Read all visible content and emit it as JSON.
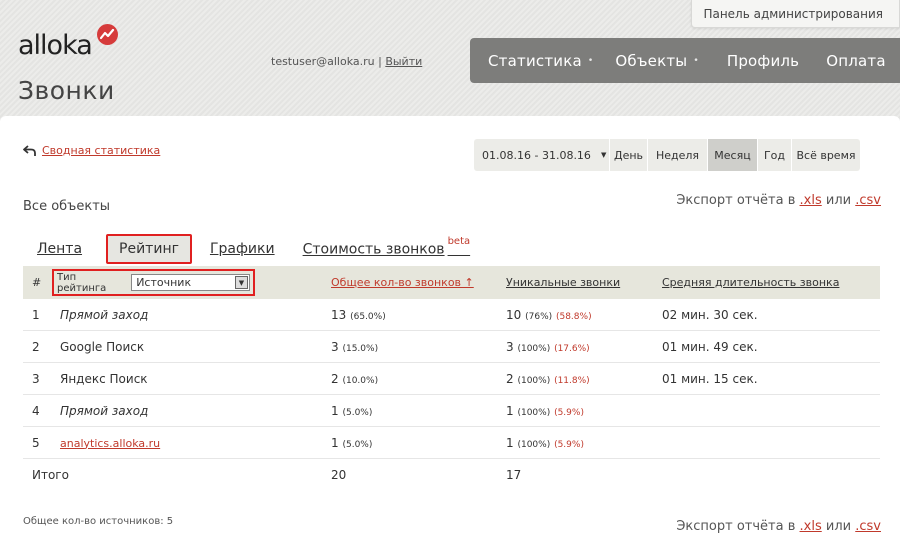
{
  "header": {
    "admin_panel": "Панель администрирования",
    "logo_text": "alloka",
    "page_title": "Звонки",
    "user_email": "testuser@alloka.ru",
    "separator": "|",
    "logout": "Выйти"
  },
  "nav": {
    "items": [
      {
        "label": "Статистика",
        "dot": "•"
      },
      {
        "label": "Объекты",
        "dot": "•"
      },
      {
        "label": "Профиль"
      },
      {
        "label": "Оплата"
      }
    ]
  },
  "content": {
    "back_link": "Сводная статистика",
    "period": {
      "date_range": "01.08.16  -  31.08.16",
      "caret": "▼",
      "buttons": [
        "День",
        "Неделя",
        "Месяц",
        "Год",
        "Всё время"
      ],
      "active": "Месяц"
    },
    "all_objects": "Все объекты",
    "export": {
      "prefix": "Экспорт отчёта в",
      "xls": ".xls",
      "or": "или",
      "csv": ".csv"
    },
    "tabs": {
      "feed": "Лента",
      "rating": "Рейтинг",
      "charts": "Графики",
      "cost": "Стоимость звонков",
      "beta": "beta"
    }
  },
  "table": {
    "headers": {
      "num": "#",
      "rating_type_label": "Тип рейтинга",
      "rating_type_value": "Источник",
      "total": "Общее кол-во звонков ↑",
      "unique": "Уникальные звонки",
      "duration": "Средняя длительность звонка"
    },
    "rows": [
      {
        "num": "1",
        "source": "Прямой заход",
        "total": "13",
        "total_pct": "(65.0%)",
        "unique": "10",
        "unique_pct": "(76%)",
        "unique_share": "(58.8%)",
        "duration": "02 мин. 30 сек."
      },
      {
        "num": "2",
        "source": "Google Поиск",
        "total": "3",
        "total_pct": "(15.0%)",
        "unique": "3",
        "unique_pct": "(100%)",
        "unique_share": "(17.6%)",
        "duration": "01 мин. 49 сек."
      },
      {
        "num": "3",
        "source": "Яндекс Поиск",
        "total": "2",
        "total_pct": "(10.0%)",
        "unique": "2",
        "unique_pct": "(100%)",
        "unique_share": "(11.8%)",
        "duration": "01 мин. 15 сек."
      },
      {
        "num": "4",
        "source": "Прямой заход",
        "total": "1",
        "total_pct": "(5.0%)",
        "unique": "1",
        "unique_pct": "(100%)",
        "unique_share": "(5.9%)",
        "duration": ""
      },
      {
        "num": "5",
        "source": "analytics.alloka.ru",
        "total": "1",
        "total_pct": "(5.0%)",
        "unique": "1",
        "unique_pct": "(100%)",
        "unique_share": "(5.9%)",
        "duration": ""
      }
    ],
    "totals": {
      "label": "Итого",
      "total": "20",
      "unique": "17"
    }
  },
  "footer": {
    "sources_count": "Общее кол-во источников: 5"
  }
}
